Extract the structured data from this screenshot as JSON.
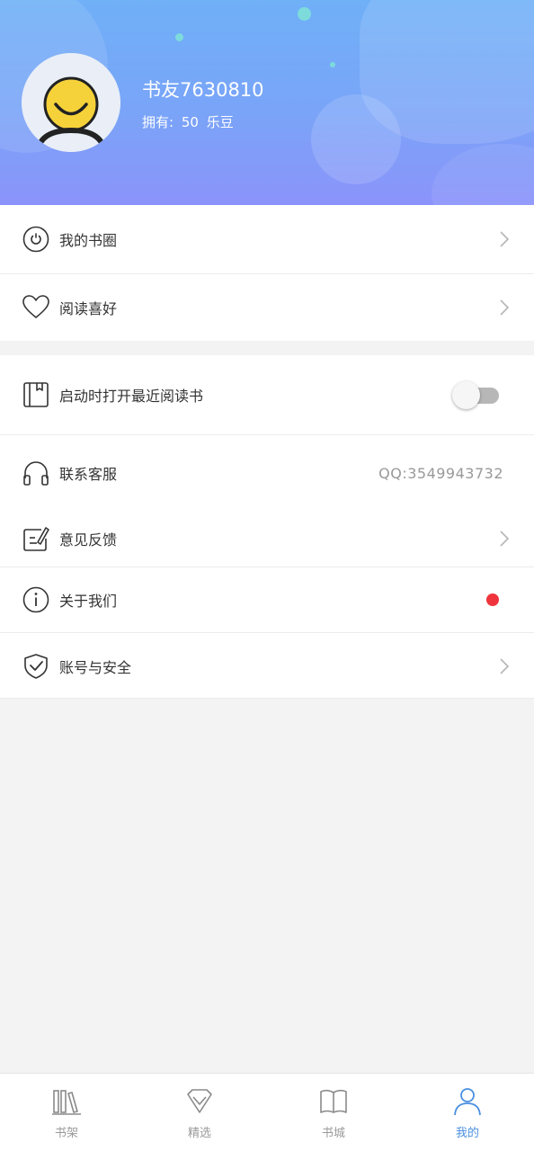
{
  "profile": {
    "username": "书友7630810",
    "coins_label": "拥有:",
    "coins_value": "50",
    "coins_unit": "乐豆"
  },
  "menu_group_1": [
    {
      "label": "我的书圈",
      "icon": "book-circle-icon"
    },
    {
      "label": "阅读喜好",
      "icon": "heart-icon"
    }
  ],
  "menu_group_2": [
    {
      "label": "启动时打开最近阅读书",
      "icon": "bookmark-book-icon",
      "toggle_on": false
    },
    {
      "label": "联系客服",
      "icon": "headphones-icon",
      "value": "QQ:3549943732"
    },
    {
      "label": "意见反馈",
      "icon": "feedback-edit-icon"
    },
    {
      "label": "关于我们",
      "icon": "info-icon",
      "badge": "red-dot"
    },
    {
      "label": "账号与安全",
      "icon": "shield-check-icon"
    }
  ],
  "tabbar": [
    {
      "label": "书架",
      "icon": "bookshelf-icon",
      "active": false
    },
    {
      "label": "精选",
      "icon": "diamond-icon",
      "active": false
    },
    {
      "label": "书城",
      "icon": "open-book-icon",
      "active": false
    },
    {
      "label": "我的",
      "icon": "person-icon",
      "active": true
    }
  ],
  "colors": {
    "header_top": "#6fb0f7",
    "header_bottom": "#8b93fa",
    "accent": "#4a8fe0",
    "badge_red": "#f0343c"
  }
}
